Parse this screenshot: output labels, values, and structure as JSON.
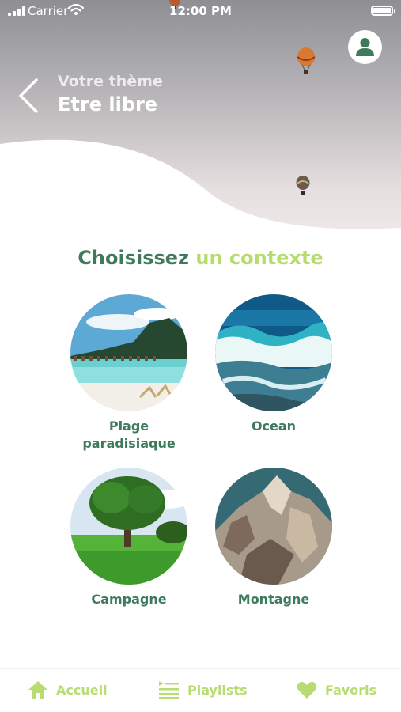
{
  "status_bar": {
    "carrier": "Carrier",
    "time": "12:00 PM"
  },
  "header": {
    "theme_label": "Votre thème",
    "theme_name": "Etre libre"
  },
  "section": {
    "title_part1": "Choisissez",
    "title_part2": "un contexte"
  },
  "contexts": [
    {
      "label": "Plage paradisiaque"
    },
    {
      "label": "Ocean"
    },
    {
      "label": "Campagne"
    },
    {
      "label": "Montagne"
    }
  ],
  "tabs": [
    {
      "label": "Accueil",
      "icon": "home-icon"
    },
    {
      "label": "Playlists",
      "icon": "playlist-icon"
    },
    {
      "label": "Favoris",
      "icon": "heart-icon"
    }
  ],
  "colors": {
    "primary_green": "#3f7a5d",
    "accent_green": "#b6dc6e",
    "tab_green": "#b8dc72"
  }
}
